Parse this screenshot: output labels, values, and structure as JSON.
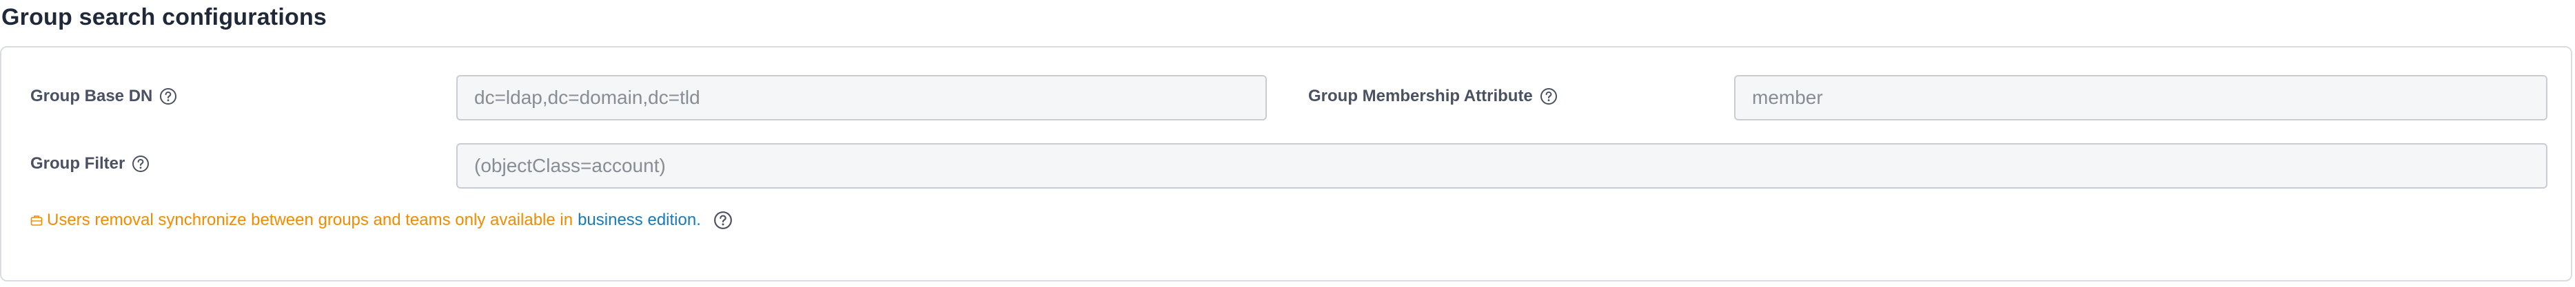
{
  "section": {
    "title": "Group search configurations"
  },
  "fields": {
    "group_base_dn": {
      "label": "Group Base DN",
      "placeholder": "dc=ldap,dc=domain,dc=tld"
    },
    "group_membership_attribute": {
      "label": "Group Membership Attribute",
      "placeholder": "member"
    },
    "group_filter": {
      "label": "Group Filter",
      "placeholder": "(objectClass=account)"
    }
  },
  "notice": {
    "text": "Users removal synchronize between groups and teams only available in",
    "link_text": "business edition."
  },
  "colors": {
    "notice": "#f08c00",
    "link": "#1a7ab8",
    "label": "#4a5160",
    "input_bg": "#f5f6f7",
    "input_border": "#c9ccd1"
  },
  "icons": [
    "help-icon",
    "briefcase-icon"
  ]
}
